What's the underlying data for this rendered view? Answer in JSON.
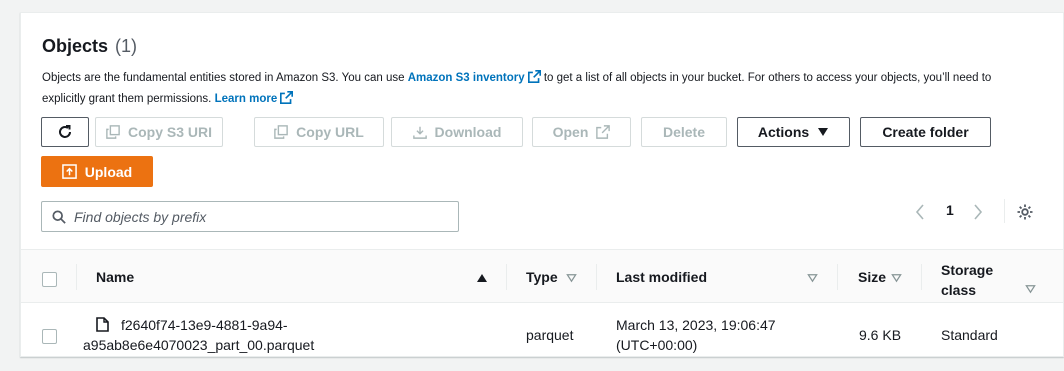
{
  "header": {
    "title": "Objects",
    "count": "(1)"
  },
  "description": {
    "text1": "Objects are the fundamental entities stored in Amazon S3. You can use",
    "inventory_link": "Amazon S3 inventory",
    "text2": "to get a list of all objects in your bucket. For others to access your objects, you’ll need to explicitly grant them permissions.",
    "learn_more": "Learn more"
  },
  "toolbar": {
    "copy_s3_uri": "Copy S3 URI",
    "copy_url": "Copy URL",
    "download": "Download",
    "open": "Open",
    "delete": "Delete",
    "actions": "Actions",
    "create_folder": "Create folder",
    "upload": "Upload"
  },
  "search": {
    "placeholder": "Find objects by prefix"
  },
  "pagination": {
    "current_page": "1"
  },
  "table": {
    "columns": {
      "name": "Name",
      "type": "Type",
      "last_modified": "Last modified",
      "size": "Size",
      "storage_class_line1": "Storage",
      "storage_class_line2": "class"
    },
    "rows": [
      {
        "name_line1": "f2640f74-13e9-4881-9a94-",
        "name_line2": "a95ab8e6e4070023_part_00.parquet",
        "type": "parquet",
        "last_modified_line1": "March 13, 2023, 19:06:47",
        "last_modified_line2": "(UTC+00:00)",
        "size": "9.6 KB",
        "storage_class": "Standard"
      }
    ]
  },
  "colors": {
    "link": "#0073bb",
    "upload": "#ec7211",
    "disabled_text": "#aab7b8"
  },
  "icons": [
    "refresh-icon",
    "copy-icon",
    "download-icon",
    "external-link-icon",
    "caret-down-icon",
    "upload-icon",
    "search-icon",
    "chevron-left-icon",
    "chevron-right-icon",
    "gear-icon",
    "sort-up-icon",
    "sort-down-icon",
    "file-icon"
  ]
}
